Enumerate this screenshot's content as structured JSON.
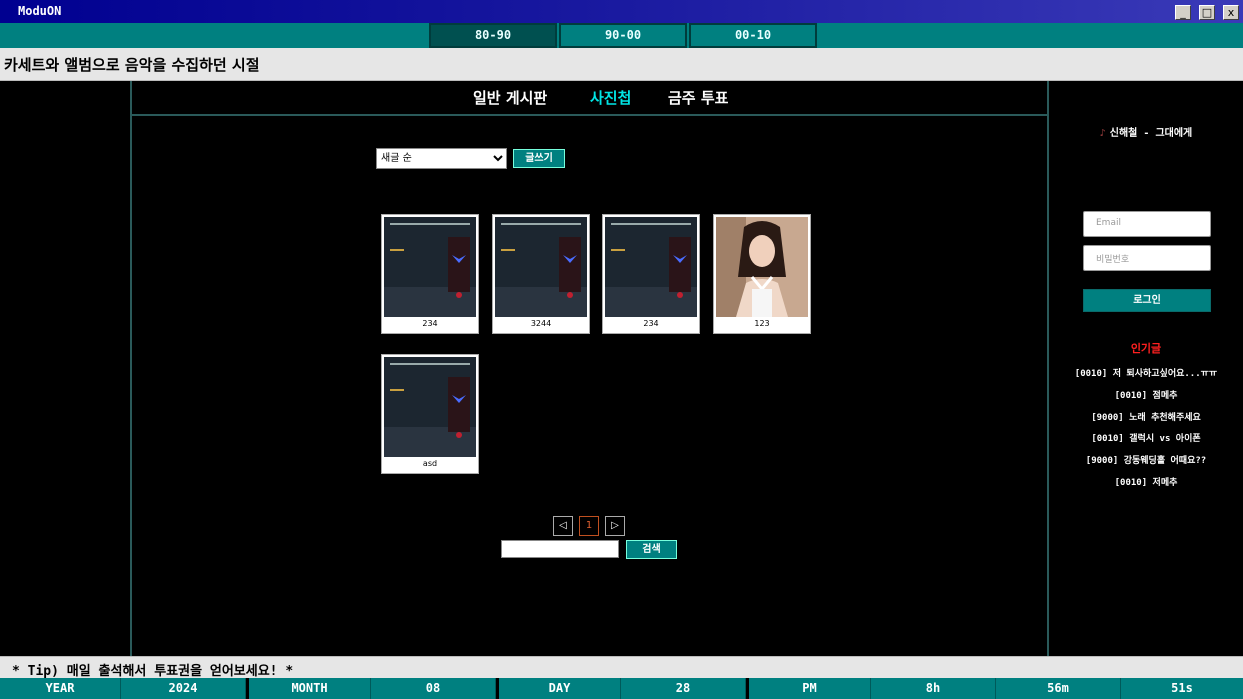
{
  "window": {
    "title": "ModuON",
    "min_label": "_",
    "max_label": "□",
    "close_label": "x"
  },
  "eras": [
    {
      "label": "80-90"
    },
    {
      "label": "90-00"
    },
    {
      "label": "00-10"
    }
  ],
  "subtitle": "카세트와 앨범으로 음악을 수집하던 시절",
  "nav": {
    "board": "일반 게시판",
    "photos": "사진첩",
    "vote": "금주 투표"
  },
  "controls": {
    "sort_selected": "새글 순",
    "write_label": "글쓰기",
    "search_label": "검색",
    "search_value": ""
  },
  "posts": [
    {
      "caption": "234",
      "thumb": "game-screenshot"
    },
    {
      "caption": "3244",
      "thumb": "game-screenshot"
    },
    {
      "caption": "234",
      "thumb": "game-screenshot"
    },
    {
      "caption": "123",
      "thumb": "portrait-photo"
    },
    {
      "caption": "asd",
      "thumb": "game-screenshot"
    }
  ],
  "pagination": {
    "prev": "◁",
    "current": "1",
    "next": "▷"
  },
  "sidebar": {
    "now_playing": "신해철 - 그대에게",
    "email_placeholder": "Email",
    "password_placeholder": "비밀번호",
    "login_label": "로그인",
    "popular_title": "인기글",
    "popular": [
      "[0010] 저 퇴사하고싶어요...ㅠㅠ",
      "[0010] 점메추",
      "[9000] 노래 추천해주세요",
      "[0010] 갤럭시 vs 아이폰",
      "[9000] 강동웨딩홀 어때요??",
      "[0010] 저메추"
    ]
  },
  "tip": "* Tip) 매일 출석해서 투표권을 얻어보세요! *",
  "status": {
    "year_label": "YEAR",
    "year": "2024",
    "month_label": "MONTH",
    "month": "08",
    "day_label": "DAY",
    "day": "28",
    "ampm": "PM",
    "hour": "8h",
    "minute": "56m",
    "second": "51s"
  },
  "colors": {
    "teal": "#008080",
    "dark_teal": "#005050",
    "active_nav": "#00e5e5",
    "popular_title": "#ff2020",
    "page_current": "#e06030"
  }
}
